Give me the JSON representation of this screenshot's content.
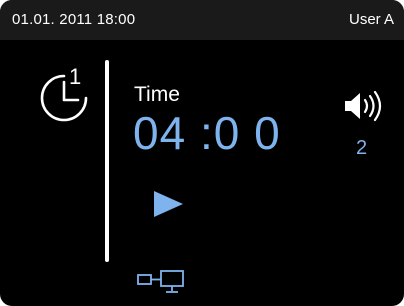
{
  "status_bar": {
    "datetime": "01.01. 2011 18:00",
    "user": "User A"
  },
  "timer": {
    "icon": "timer-1-icon",
    "label": "Time",
    "value": "04 :0 0"
  },
  "volume": {
    "icon": "speaker-volume-icon",
    "level": "2"
  },
  "play": {
    "icon": "play-icon"
  },
  "network": {
    "icon": "network-connection-icon"
  },
  "colors": {
    "background": "#000000",
    "status_bar": "#1a1a1a",
    "text": "#ffffff",
    "accent": "#7fb3ee"
  }
}
